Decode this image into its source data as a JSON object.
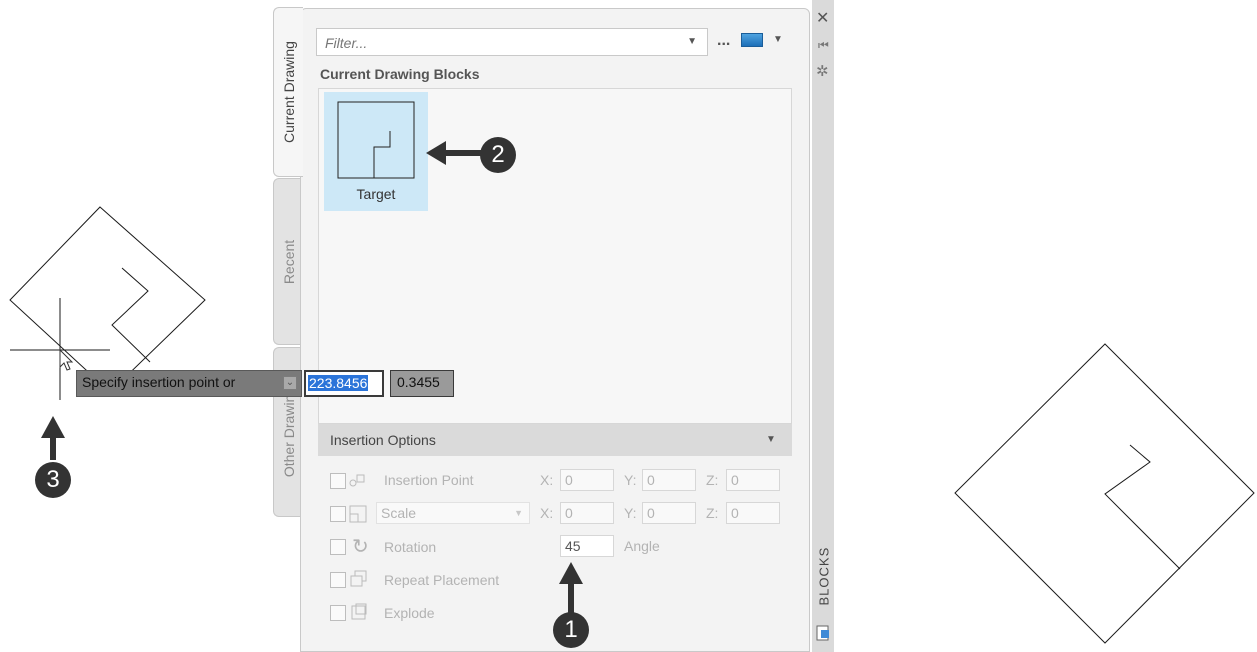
{
  "palette": {
    "tabs": [
      {
        "label": "Current Drawing",
        "active": true
      },
      {
        "label": "Recent",
        "active": false
      },
      {
        "label": "Other Drawing",
        "active": false
      }
    ],
    "filter_placeholder": "Filter...",
    "more_label": "...",
    "section_title": "Current Drawing Blocks",
    "blocks": [
      {
        "label": "Target",
        "selected": true
      }
    ],
    "side_title": "BLOCKS",
    "icons": [
      "close-icon",
      "pin-icon",
      "settings-icon",
      "view-mode-icon",
      "dropdown-arrow-icon"
    ]
  },
  "insertion_options": {
    "title": "Insertion Options",
    "insertion_point": {
      "label": "Insertion Point",
      "x_label": "X:",
      "x": "0",
      "y_label": "Y:",
      "y": "0",
      "z_label": "Z:",
      "z": "0"
    },
    "scale": {
      "label": "Scale",
      "x_label": "X:",
      "x": "0",
      "y_label": "Y:",
      "y": "0",
      "z_label": "Z:",
      "z": "0"
    },
    "rotation": {
      "label": "Rotation",
      "value": "45",
      "angle_label": "Angle"
    },
    "repeat_placement": {
      "label": "Repeat Placement"
    },
    "explode": {
      "label": "Explode"
    }
  },
  "command_prompt": {
    "text": "Specify insertion point or",
    "x_value": "223.8456",
    "y_value": "0.3455"
  },
  "callouts": [
    "1",
    "2",
    "3"
  ],
  "colors": {
    "selection": "#cde8f7",
    "accent": "#2b74d9",
    "callout": "#333333"
  }
}
